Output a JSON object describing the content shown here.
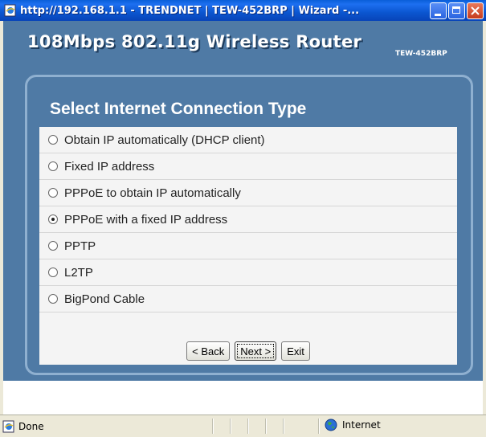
{
  "window": {
    "title": "http://192.168.1.1 - TRENDNET | TEW-452BRP | Wizard -...",
    "controls": [
      "minimize-icon",
      "maximize-icon",
      "close-icon"
    ]
  },
  "router": {
    "title": "108Mbps 802.11g Wireless Router",
    "model": "TEW-452BRP"
  },
  "panel": {
    "title": "Select Internet Connection Type",
    "options": [
      {
        "label": "Obtain IP automatically (DHCP client)",
        "selected": false
      },
      {
        "label": "Fixed IP address",
        "selected": false
      },
      {
        "label": "PPPoE to obtain IP automatically",
        "selected": false
      },
      {
        "label": "PPPoE with a fixed IP address",
        "selected": true
      },
      {
        "label": "PPTP",
        "selected": false
      },
      {
        "label": "L2TP",
        "selected": false
      },
      {
        "label": "BigPond Cable",
        "selected": false
      }
    ]
  },
  "buttons": {
    "back": "< Back",
    "next": "Next >",
    "exit": "Exit"
  },
  "status": {
    "text": "Done",
    "zone": "Internet"
  },
  "colors": {
    "header_blue": "#4f7aa5",
    "titlebar_blue": "#0b56d0"
  }
}
